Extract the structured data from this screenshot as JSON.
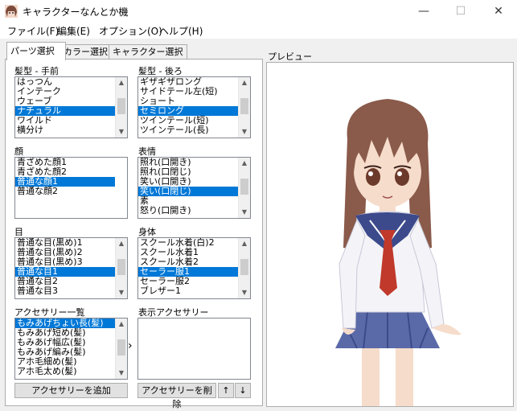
{
  "window": {
    "title": "キャラクターなんとか機",
    "min": "—",
    "max": "☐",
    "close": "✕"
  },
  "menu": [
    "ファイル(F)",
    "編集(E)",
    "オプション(O)",
    "ヘルプ(H)"
  ],
  "tabs": [
    "パーツ選択",
    "カラー選択",
    "キャラクター選択"
  ],
  "preview_label": "プレビュー",
  "lists": {
    "hair_front": {
      "label": "髪型 - 手前",
      "items": [
        "はっつん",
        "インテーク",
        "ウェーブ",
        "ナチュラル",
        "ワイルド",
        "横分け"
      ],
      "selected": 3
    },
    "hair_back": {
      "label": "髪型 - 後ろ",
      "items": [
        "ギザギザロング",
        "サイドテール左(短)",
        "ショート",
        "セミロング",
        "ツインテール(短)",
        "ツインテール(長)"
      ],
      "selected": 3
    },
    "face": {
      "label": "顔",
      "items": [
        "青ざめた顔1",
        "青ざめた顔2",
        "普通な顔1",
        "普通な顔2"
      ],
      "selected": 2
    },
    "expression": {
      "label": "表情",
      "items": [
        "照れ(口開き)",
        "照れ(口閉じ)",
        "笑い(口開き)",
        "笑い(口閉じ)",
        "素",
        "怒り(口開き)"
      ],
      "selected": 3
    },
    "eyes": {
      "label": "目",
      "items": [
        "普通な目(黒め)1",
        "普通な目(黒め)2",
        "普通な目(黒め)3",
        "普通な目1",
        "普通な目2",
        "普通な目3"
      ],
      "selected": 3
    },
    "body": {
      "label": "身体",
      "items": [
        "スクール水着(白)2",
        "スクール水着1",
        "スクール水着2",
        "セーラー服1",
        "セーラー服2",
        "ブレザー1"
      ],
      "selected": 3
    },
    "accessory_list": {
      "label": "アクセサリー一覧",
      "items": [
        "もみあげちょい長(髪)",
        "もみあげ短め(髪)",
        "もみあげ幅広(髪)",
        "もみあげ編み(髪)",
        "アホ毛細め(髪)",
        "アホ毛太め(髪)"
      ],
      "selected": 0
    },
    "shown_accessories": {
      "label": "表示アクセサリー",
      "items": [],
      "selected": -1
    }
  },
  "buttons": {
    "add": "アクセサリーを追加",
    "remove": "アクセサリーを削除",
    "up": "↑",
    "down": "↓",
    "move": "›"
  },
  "colors": {
    "selection": "#0078d7",
    "hair": "#8a5a4a",
    "sailor_navy": "#3c4a8c",
    "tie": "#c0392b"
  }
}
